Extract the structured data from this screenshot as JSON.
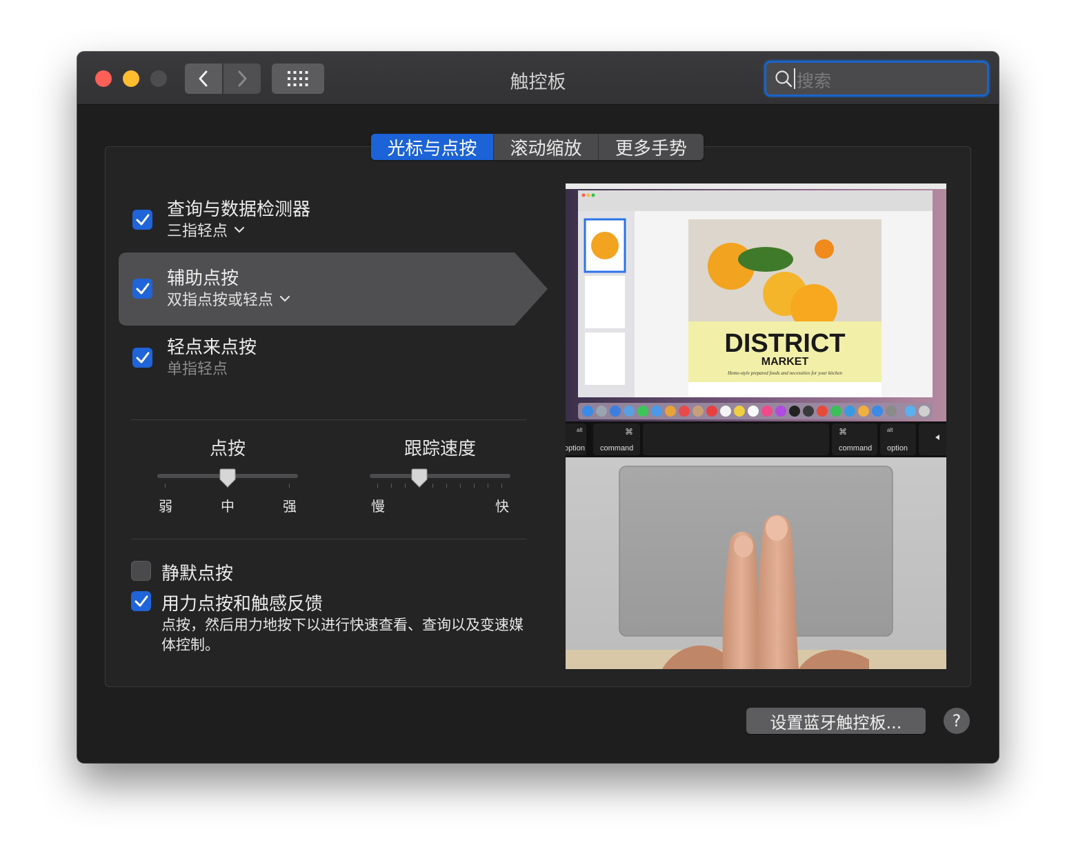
{
  "window": {
    "title": "触控板"
  },
  "search": {
    "placeholder": "搜索"
  },
  "tabs": [
    {
      "label": "光标与点按",
      "active": true
    },
    {
      "label": "滚动缩放",
      "active": false
    },
    {
      "label": "更多手势",
      "active": false
    }
  ],
  "options": [
    {
      "title": "查询与数据检测器",
      "subtitle": "三指轻点",
      "checked": true,
      "has_menu": true
    },
    {
      "title": "辅助点按",
      "subtitle": "双指点按或轻点",
      "checked": true,
      "has_menu": true,
      "selected": true
    },
    {
      "title": "轻点来点按",
      "subtitle": "单指轻点",
      "checked": true,
      "has_menu": false
    }
  ],
  "sliders": {
    "click": {
      "title": "点按",
      "labels": [
        "弱",
        "中",
        "强"
      ],
      "value": "中"
    },
    "tracking": {
      "title": "跟踪速度",
      "labels": [
        "慢",
        "快"
      ],
      "value_fraction": 0.35
    }
  },
  "silent_click": {
    "label": "静默点按",
    "checked": false
  },
  "force_click": {
    "label": "用力点按和触感反馈",
    "checked": true,
    "description": "点按，然后用力地按下以进行快速查看、查询以及变速媒体控制。"
  },
  "preview": {
    "doc_title": "DISTRICT",
    "doc_subtitle": "MARKET",
    "doc_tagline": "Home-style prepared foods and necessities for your kitchen",
    "keys": [
      "option",
      "command",
      "command",
      "option"
    ],
    "key_mods": [
      "alt",
      "⌘",
      "⌘",
      "alt"
    ]
  },
  "buttons": {
    "bluetooth": "设置蓝牙触控板...",
    "help": "?"
  },
  "colors": {
    "accent": "#1f64d9",
    "window_bg": "#1e1e1e",
    "panel_bg": "#242424"
  }
}
